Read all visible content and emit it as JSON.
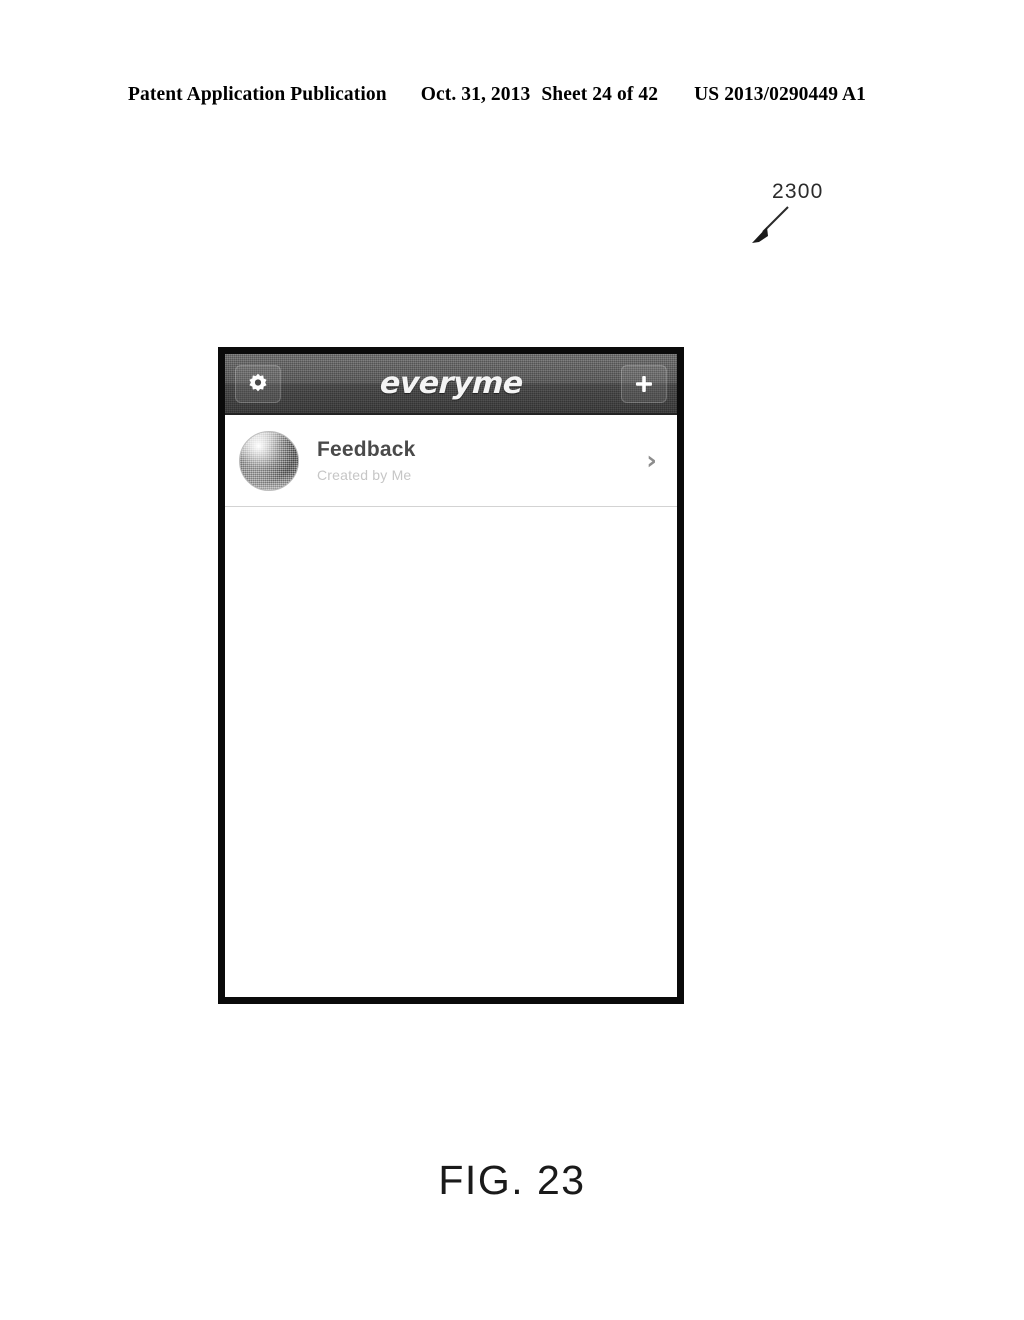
{
  "patent_header": {
    "publication": "Patent Application Publication",
    "date": "Oct. 31, 2013",
    "sheet": "Sheet 24 of 42",
    "number": "US 2013/0290449 A1"
  },
  "figure": {
    "reference_numeral": "2300",
    "caption": "FIG. 23",
    "arrow_icon": "leader-arrow-icon"
  },
  "device": {
    "navbar": {
      "settings_icon": "gear-icon",
      "title": "everyme",
      "add_icon": "plus-icon",
      "background_color": "#4a4a4a",
      "text_color": "#f4f4f4"
    },
    "list": {
      "rows": [
        {
          "avatar": "circle-photo-avatar",
          "title": "Feedback",
          "subtitle": "Created by Me",
          "disclosure_icon": "chevron-right-icon"
        }
      ]
    }
  }
}
